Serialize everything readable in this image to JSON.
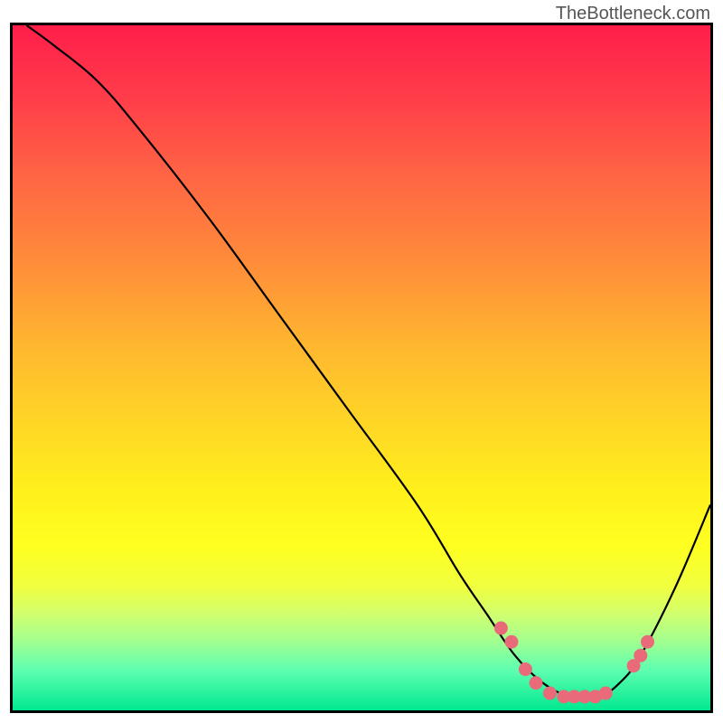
{
  "attribution": "TheBottleneck.com",
  "chart_data": {
    "type": "line",
    "title": "",
    "xlabel": "",
    "ylabel": "",
    "xlim": [
      0,
      100
    ],
    "ylim": [
      0,
      100
    ],
    "curve_points": [
      {
        "x": 2,
        "y": 100
      },
      {
        "x": 6,
        "y": 97
      },
      {
        "x": 12,
        "y": 92
      },
      {
        "x": 18,
        "y": 85
      },
      {
        "x": 28,
        "y": 72
      },
      {
        "x": 38,
        "y": 58
      },
      {
        "x": 48,
        "y": 44
      },
      {
        "x": 58,
        "y": 30
      },
      {
        "x": 64,
        "y": 20
      },
      {
        "x": 68,
        "y": 14
      },
      {
        "x": 72,
        "y": 8
      },
      {
        "x": 76,
        "y": 4
      },
      {
        "x": 80,
        "y": 2
      },
      {
        "x": 84,
        "y": 2
      },
      {
        "x": 87,
        "y": 4
      },
      {
        "x": 90,
        "y": 8
      },
      {
        "x": 95,
        "y": 18
      },
      {
        "x": 100,
        "y": 30
      }
    ],
    "markers": [
      {
        "x": 70,
        "y": 12
      },
      {
        "x": 71.5,
        "y": 10
      },
      {
        "x": 73.5,
        "y": 6
      },
      {
        "x": 75,
        "y": 4
      },
      {
        "x": 77,
        "y": 2.5
      },
      {
        "x": 79,
        "y": 2
      },
      {
        "x": 80.5,
        "y": 2
      },
      {
        "x": 82,
        "y": 2
      },
      {
        "x": 83.5,
        "y": 2
      },
      {
        "x": 85,
        "y": 2.5
      },
      {
        "x": 89,
        "y": 6.5
      },
      {
        "x": 90,
        "y": 8
      },
      {
        "x": 91,
        "y": 10
      }
    ],
    "marker_color": "#e96b7a",
    "gradient_stops": [
      {
        "pos": 0.0,
        "color": "#ff1e4a"
      },
      {
        "pos": 0.5,
        "color": "#ffd626"
      },
      {
        "pos": 0.85,
        "color": "#e0ff60"
      },
      {
        "pos": 1.0,
        "color": "#00e890"
      }
    ]
  }
}
